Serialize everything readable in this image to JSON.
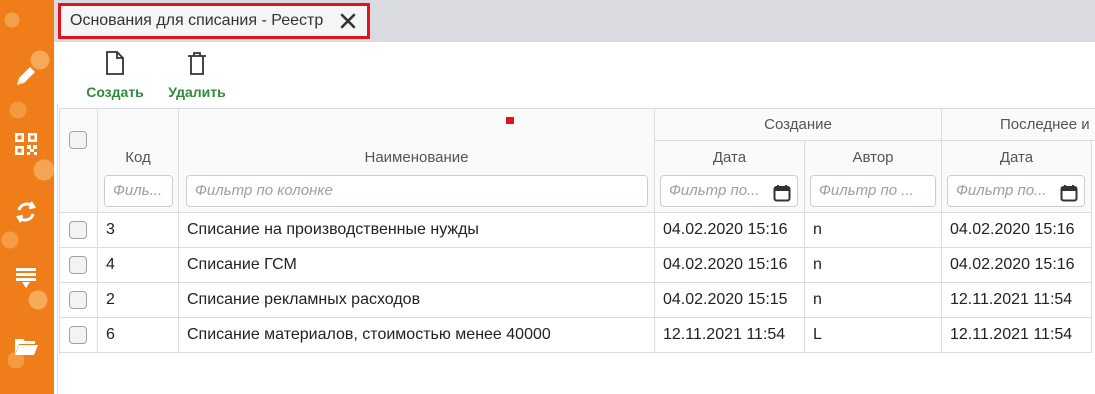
{
  "window": {
    "tab_title": "Основания для списания - Реестр",
    "accent_color": "#e0141c",
    "rail_color": "#ef7d1a"
  },
  "rail": {
    "icons": [
      "pencil-icon",
      "qr-code-icon",
      "sync-icon",
      "download-list-icon",
      "folder-open-icon"
    ]
  },
  "toolbar": {
    "create_label": "Создать",
    "delete_label": "Удалить",
    "label_color": "#2e8b3a"
  },
  "table": {
    "group_headers": {
      "creation": "Создание",
      "last_change": "Последнее и"
    },
    "columns": {
      "code": "Код",
      "name": "Наименование",
      "created_date": "Дата",
      "created_author": "Автор",
      "changed_date": "Дата"
    },
    "filters": {
      "code": "Филь...",
      "name": "Фильтр по колонке",
      "created_date": "Фильтр по...",
      "created_author": "Фильтр по ...",
      "changed_date": "Фильтр по..."
    },
    "rows": [
      {
        "code": "3",
        "name": "Списание на производственные нужды",
        "created_date": "04.02.2020 15:16",
        "author": "n",
        "changed_date": "04.02.2020 15:16"
      },
      {
        "code": "4",
        "name": "Списание ГСМ",
        "created_date": "04.02.2020 15:16",
        "author": "n",
        "changed_date": "04.02.2020 15:16"
      },
      {
        "code": "2",
        "name": "Списание рекламных расходов",
        "created_date": "04.02.2020 15:15",
        "author": "n",
        "changed_date": "12.11.2021 11:54"
      },
      {
        "code": "6",
        "name": "Списание материалов, стоимостью менее 40000",
        "created_date": "12.11.2021 11:54",
        "author": "L",
        "changed_date": "12.11.2021 11:54"
      }
    ]
  }
}
